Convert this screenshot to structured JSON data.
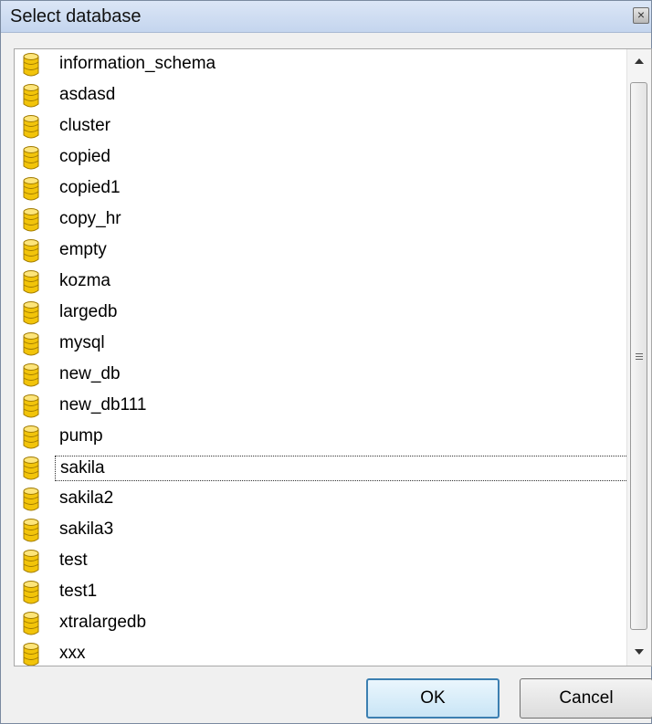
{
  "window": {
    "title": "Select database",
    "close_glyph": "×"
  },
  "icon": "database-icon",
  "list": {
    "items": [
      "information_schema",
      "asdasd",
      "cluster",
      "copied",
      "copied1",
      "copy_hr",
      "empty",
      "kozma",
      "largedb",
      "mysql",
      "new_db",
      "new_db111",
      "pump",
      "sakila",
      "sakila2",
      "sakila3",
      "test",
      "test1",
      "xtralargedb",
      "xxx"
    ],
    "focused_item": "sakila"
  },
  "buttons": {
    "ok_label": "OK",
    "cancel_label": "Cancel"
  },
  "colors": {
    "title_bar": "#c8d8ee",
    "icon_fill": "#f2c40a",
    "focus_border": "#333333"
  }
}
